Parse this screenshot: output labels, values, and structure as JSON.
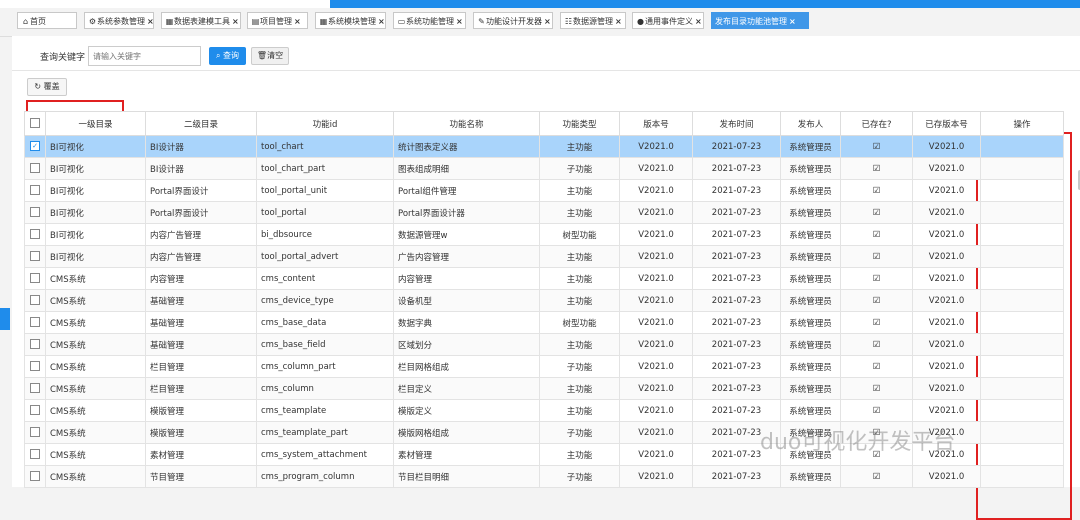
{
  "tabs": [
    {
      "icon": "home-icon",
      "glyph": "⌂",
      "label": "首页",
      "closable": false
    },
    {
      "icon": "gear-icon",
      "glyph": "⚙",
      "label": "系统参数管理",
      "closable": true
    },
    {
      "icon": "grid-icon",
      "glyph": "▦",
      "label": "数据表建模工具",
      "closable": true
    },
    {
      "icon": "list-icon",
      "glyph": "▤",
      "label": "项目管理",
      "closable": true
    },
    {
      "icon": "module-icon",
      "glyph": "▦",
      "label": "系统模块管理",
      "closable": true
    },
    {
      "icon": "monitor-icon",
      "glyph": "▭",
      "label": "系统功能管理",
      "closable": true
    },
    {
      "icon": "wrench-icon",
      "glyph": "✎",
      "label": "功能设计开发器",
      "closable": true
    },
    {
      "icon": "database-icon",
      "glyph": "☷",
      "label": "数据源管理",
      "closable": true
    },
    {
      "icon": "info-icon",
      "glyph": "●",
      "label": "通用事件定义",
      "closable": true
    },
    {
      "icon": "",
      "glyph": "",
      "label": "发布目录功能池管理",
      "closable": true,
      "active": true
    }
  ],
  "search": {
    "label": "查询关键字",
    "placeholder": "请输入关键字",
    "query_label": "查询",
    "clear_label": "清空"
  },
  "cover_label": "覆盖",
  "columns": [
    "一级目录",
    "二级目录",
    "功能id",
    "功能名称",
    "功能类型",
    "版本号",
    "发布时间",
    "发布人",
    "已存在?",
    "已存版本号",
    "操作"
  ],
  "rows": [
    {
      "l1": "BI可视化",
      "l2": "BI设计器",
      "fid": "tool_chart",
      "name": "统计图表定义器",
      "type": "主功能",
      "ver": "V2021.0",
      "date": "2021-07-23",
      "pub": "系统管理员",
      "exists": true,
      "saved": "V2021.0",
      "selected": true
    },
    {
      "l1": "BI可视化",
      "l2": "BI设计器",
      "fid": "tool_chart_part",
      "name": "图表组成明细",
      "type": "子功能",
      "ver": "V2021.0",
      "date": "2021-07-23",
      "pub": "系统管理员",
      "exists": true,
      "saved": "V2021.0"
    },
    {
      "l1": "BI可视化",
      "l2": "Portal界面设计",
      "fid": "tool_portal_unit",
      "name": "Portal组件管理",
      "type": "主功能",
      "ver": "V2021.0",
      "date": "2021-07-23",
      "pub": "系统管理员",
      "exists": true,
      "saved": "V2021.0"
    },
    {
      "l1": "BI可视化",
      "l2": "Portal界面设计",
      "fid": "tool_portal",
      "name": "Portal界面设计器",
      "type": "主功能",
      "ver": "V2021.0",
      "date": "2021-07-23",
      "pub": "系统管理员",
      "exists": true,
      "saved": "V2021.0"
    },
    {
      "l1": "BI可视化",
      "l2": "内容广告管理",
      "fid": "bi_dbsource",
      "name": "数据源管理w",
      "type": "树型功能",
      "ver": "V2021.0",
      "date": "2021-07-23",
      "pub": "系统管理员",
      "exists": true,
      "saved": "V2021.0"
    },
    {
      "l1": "BI可视化",
      "l2": "内容广告管理",
      "fid": "tool_portal_advert",
      "name": "广告内容管理",
      "type": "主功能",
      "ver": "V2021.0",
      "date": "2021-07-23",
      "pub": "系统管理员",
      "exists": true,
      "saved": "V2021.0"
    },
    {
      "l1": "CMS系统",
      "l2": "内容管理",
      "fid": "cms_content",
      "name": "内容管理",
      "type": "主功能",
      "ver": "V2021.0",
      "date": "2021-07-23",
      "pub": "系统管理员",
      "exists": true,
      "saved": "V2021.0"
    },
    {
      "l1": "CMS系统",
      "l2": "基础管理",
      "fid": "cms_device_type",
      "name": "设备机型",
      "type": "主功能",
      "ver": "V2021.0",
      "date": "2021-07-23",
      "pub": "系统管理员",
      "exists": true,
      "saved": "V2021.0"
    },
    {
      "l1": "CMS系统",
      "l2": "基础管理",
      "fid": "cms_base_data",
      "name": "数据字典",
      "type": "树型功能",
      "ver": "V2021.0",
      "date": "2021-07-23",
      "pub": "系统管理员",
      "exists": true,
      "saved": "V2021.0"
    },
    {
      "l1": "CMS系统",
      "l2": "基础管理",
      "fid": "cms_base_field",
      "name": "区域划分",
      "type": "主功能",
      "ver": "V2021.0",
      "date": "2021-07-23",
      "pub": "系统管理员",
      "exists": true,
      "saved": "V2021.0"
    },
    {
      "l1": "CMS系统",
      "l2": "栏目管理",
      "fid": "cms_column_part",
      "name": "栏目网格组成",
      "type": "子功能",
      "ver": "V2021.0",
      "date": "2021-07-23",
      "pub": "系统管理员",
      "exists": true,
      "saved": "V2021.0"
    },
    {
      "l1": "CMS系统",
      "l2": "栏目管理",
      "fid": "cms_column",
      "name": "栏目定义",
      "type": "主功能",
      "ver": "V2021.0",
      "date": "2021-07-23",
      "pub": "系统管理员",
      "exists": true,
      "saved": "V2021.0"
    },
    {
      "l1": "CMS系统",
      "l2": "模版管理",
      "fid": "cms_teamplate",
      "name": "模版定义",
      "type": "主功能",
      "ver": "V2021.0",
      "date": "2021-07-23",
      "pub": "系统管理员",
      "exists": true,
      "saved": "V2021.0"
    },
    {
      "l1": "CMS系统",
      "l2": "模版管理",
      "fid": "cms_teamplate_part",
      "name": "模版网格组成",
      "type": "子功能",
      "ver": "V2021.0",
      "date": "2021-07-23",
      "pub": "系统管理员",
      "exists": true,
      "saved": "V2021.0"
    },
    {
      "l1": "CMS系统",
      "l2": "素材管理",
      "fid": "cms_system_attachment",
      "name": "素材管理",
      "type": "主功能",
      "ver": "V2021.0",
      "date": "2021-07-23",
      "pub": "系统管理员",
      "exists": true,
      "saved": "V2021.0"
    },
    {
      "l1": "CMS系统",
      "l2": "节目管理",
      "fid": "cms_program_column",
      "name": "节目栏目明细",
      "type": "子功能",
      "ver": "V2021.0",
      "date": "2021-07-23",
      "pub": "系统管理员",
      "exists": true,
      "saved": "V2021.0"
    }
  ],
  "watermark": "duo可视化开发平台",
  "colors": {
    "accent": "#1f8ceb",
    "selected_row": "#a9d4fb",
    "highlight_box": "#e02020"
  }
}
